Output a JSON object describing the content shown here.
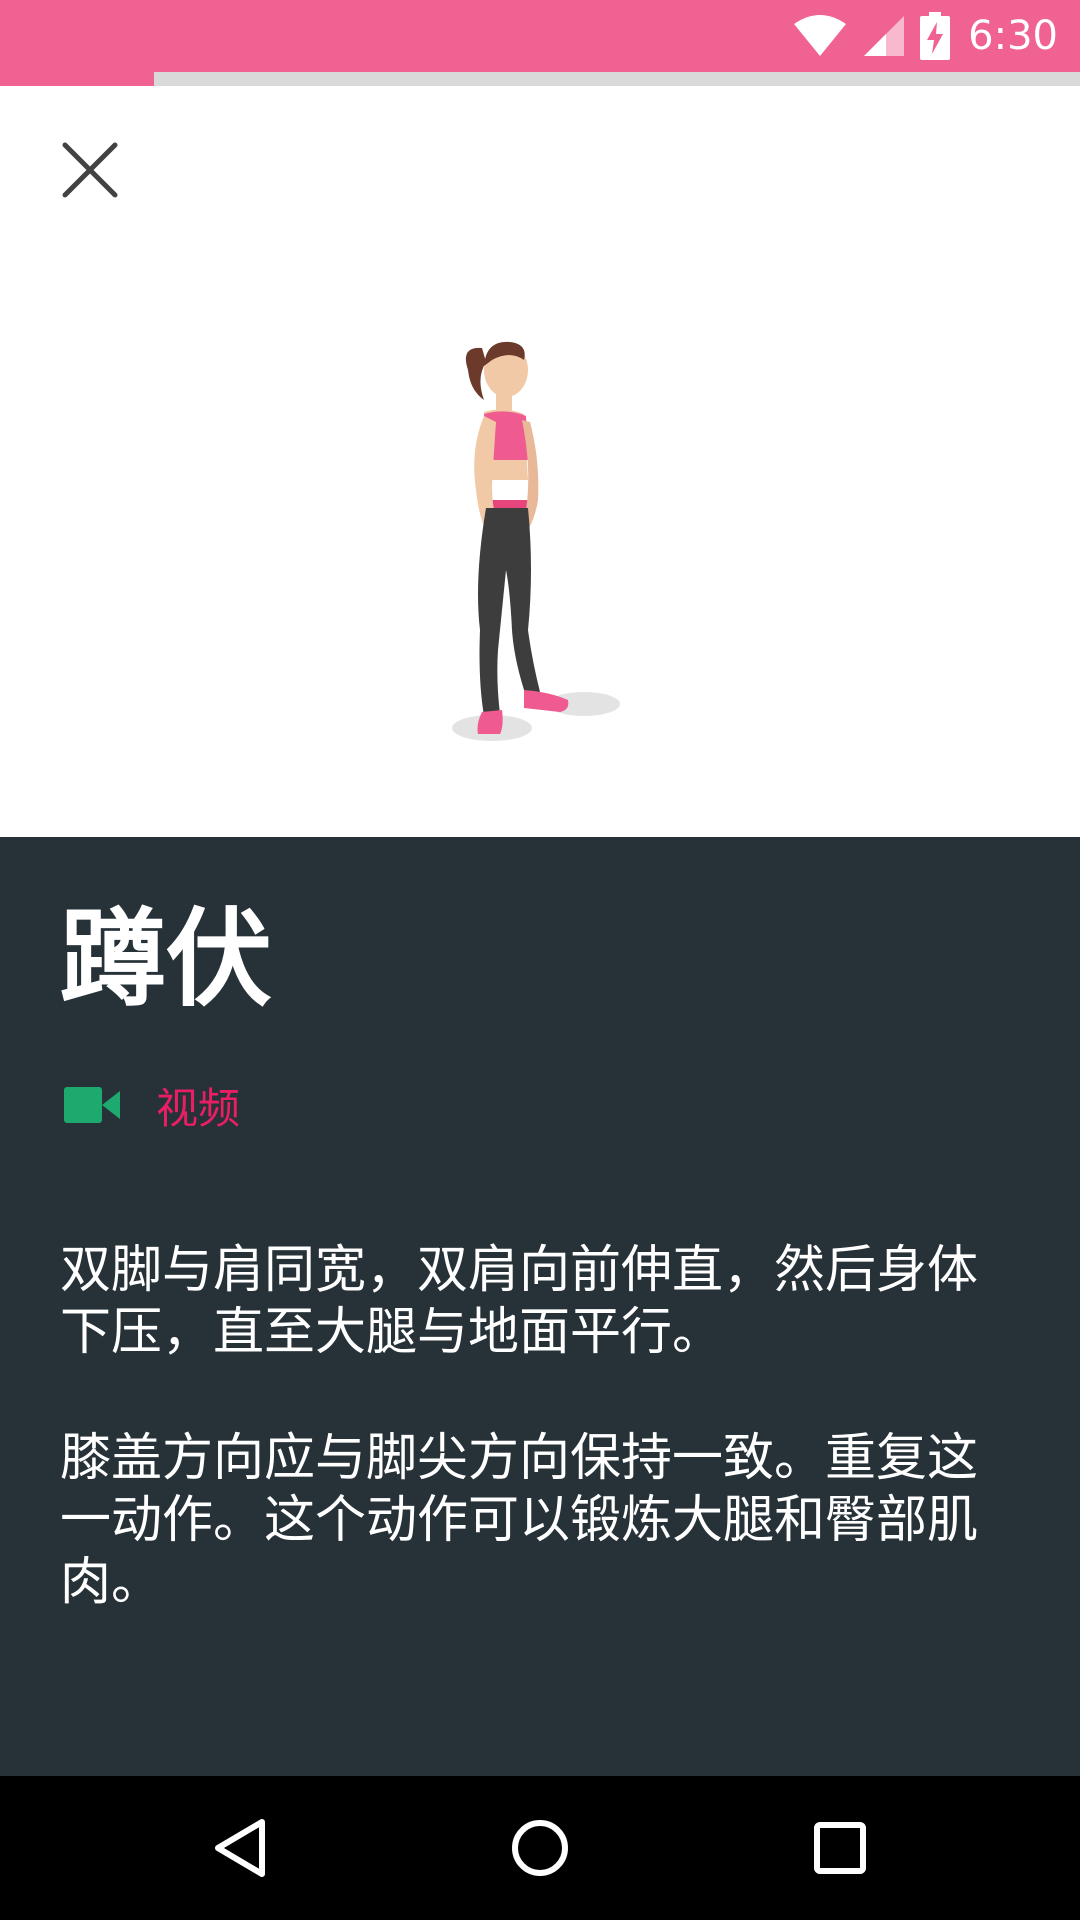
{
  "status_bar": {
    "time": "6:30",
    "icons": [
      "wifi-icon",
      "cell-signal-icon",
      "battery-charging-icon"
    ],
    "color": "#f06292"
  },
  "workout_progress": {
    "fraction": 0.143
  },
  "toolbar": {
    "close_icon": "close-icon"
  },
  "exercise": {
    "title": "蹲伏",
    "video_label": "视频",
    "video_icon": "video-camera-icon",
    "description": [
      "双脚与肩同宽，双肩向前伸直，然后身体下压，直至大腿与地面平行。",
      "膝盖方向应与脚尖方向保持一致。重复这一动作。这个动作可以锻炼大腿和臀部肌肉。"
    ]
  },
  "nav_bar": {
    "icons": [
      "back-icon",
      "home-icon",
      "recents-icon"
    ]
  },
  "colors": {
    "accent": "#f06292",
    "panel": "#263238",
    "video_icon": "#1eaa6e",
    "video_text": "#e91e63"
  }
}
